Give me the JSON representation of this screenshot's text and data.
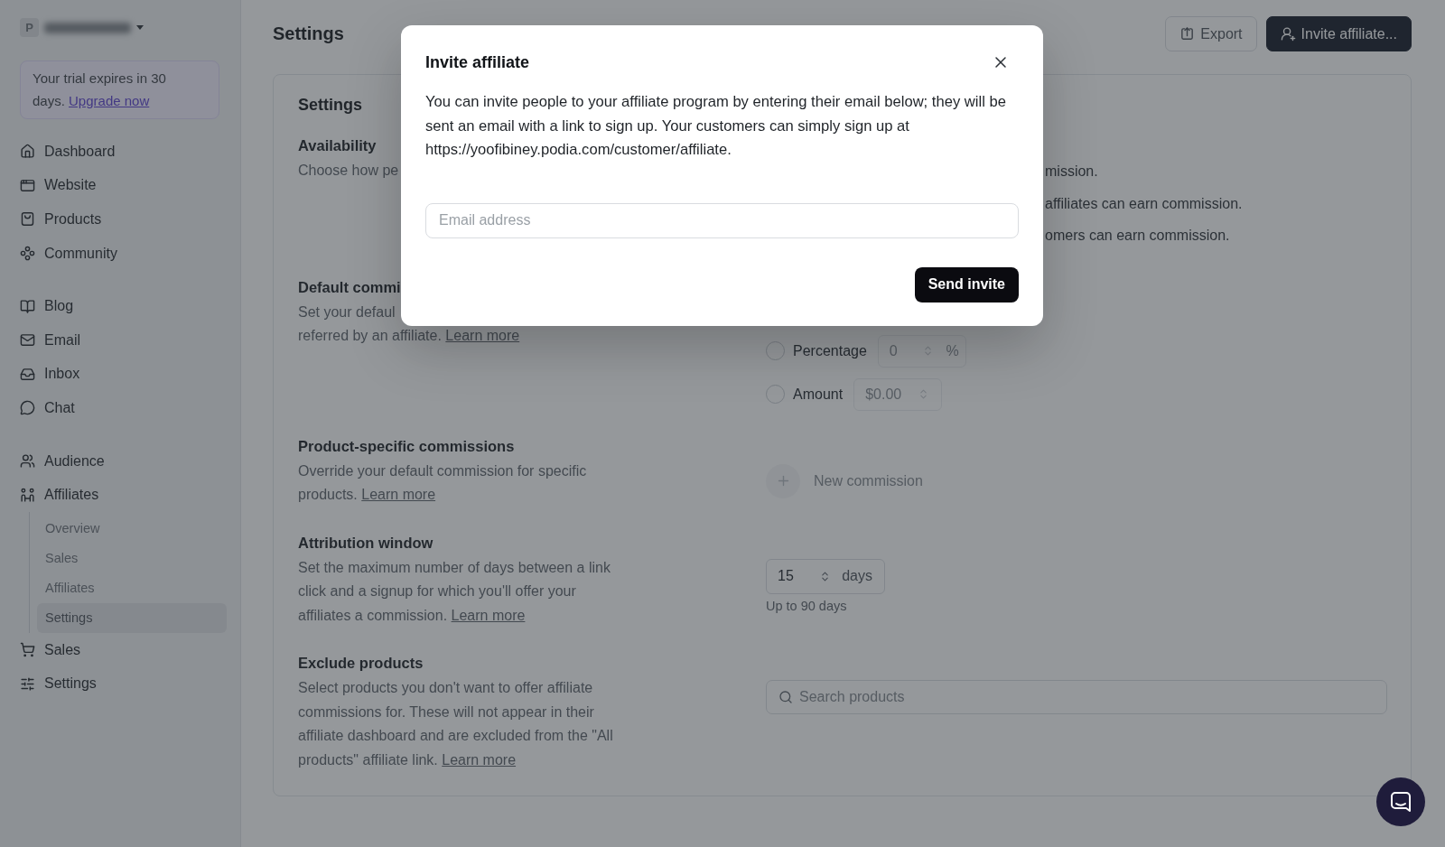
{
  "workspace": {
    "initial": "P"
  },
  "trial_notice": {
    "text": "Your trial expires in 30 days.",
    "link": "Upgrade now"
  },
  "sidebar": {
    "groups": [
      {
        "items": [
          {
            "label": "Dashboard",
            "selected": false
          },
          {
            "label": "Website",
            "selected": false
          },
          {
            "label": "Products",
            "selected": false
          },
          {
            "label": "Community",
            "selected": false
          }
        ]
      },
      {
        "items": [
          {
            "label": "Blog",
            "selected": false
          },
          {
            "label": "Email",
            "selected": false
          },
          {
            "label": "Inbox",
            "selected": false
          },
          {
            "label": "Chat",
            "selected": false
          }
        ]
      },
      {
        "items": [
          {
            "label": "Audience",
            "selected": false
          },
          {
            "label": "Affiliates",
            "selected": false,
            "children": [
              {
                "label": "Overview",
                "selected": false
              },
              {
                "label": "Sales",
                "selected": false
              },
              {
                "label": "Affiliates",
                "selected": false
              },
              {
                "label": "Settings",
                "selected": true
              }
            ]
          },
          {
            "label": "Sales",
            "selected": false
          },
          {
            "label": "Settings",
            "selected": false
          }
        ]
      }
    ]
  },
  "page": {
    "title": "Settings",
    "actions": [
      {
        "label": "Export",
        "kind": "secondary"
      },
      {
        "label": "Invite affiliate...",
        "kind": "primary"
      }
    ]
  },
  "settings_card": {
    "title": "Settings",
    "sections": [
      {
        "kind": "availability",
        "heading": "Availability",
        "description": "Choose how pe",
        "options": [
          {
            "label": "mission."
          },
          {
            "label": "affiliates can earn commission."
          },
          {
            "label": "omers can earn commission."
          }
        ]
      },
      {
        "kind": "default_commission",
        "heading": "Default commi",
        "cut_line": "Set your defaul",
        "description": "referred by an affiliate.",
        "link": "Learn more",
        "options": [
          {
            "label": "Percentage",
            "selected": false,
            "input": {
              "placeholder": "0",
              "unit": "%",
              "disabled": true
            }
          },
          {
            "label": "Amount",
            "selected": false,
            "input": {
              "placeholder": "$0.00",
              "disabled": true
            }
          }
        ]
      },
      {
        "kind": "product_commissions",
        "heading": "Product-specific commissions",
        "description": "Override your default commission for specific products.",
        "link": "Learn more",
        "action": {
          "label": "New commission",
          "disabled": true
        }
      },
      {
        "kind": "attribution",
        "heading": "Attribution window",
        "description": "Set the maximum number of days between a link click and a signup for which you'll offer your affiliates a commission.",
        "link": "Learn more",
        "input": {
          "value": "15",
          "unit": "days"
        },
        "hint": "Up to 90 days"
      },
      {
        "kind": "exclude",
        "heading": "Exclude products",
        "description": "Select products you don't want to offer affiliate commissions for. These will not appear in their affiliate dashboard and are excluded from the \"All products\" affiliate link.",
        "link": "Learn more",
        "search": {
          "placeholder": "Search products"
        }
      }
    ]
  },
  "modal": {
    "title": "Invite affiliate",
    "text": "You can invite people to your affiliate program by entering their email below; they will be sent an email with a link to sign up. Your customers can simply sign up at https://yoofibiney.podia.com/customer/affiliate.",
    "email": {
      "placeholder": "Email address"
    },
    "submit": "Send invite"
  }
}
